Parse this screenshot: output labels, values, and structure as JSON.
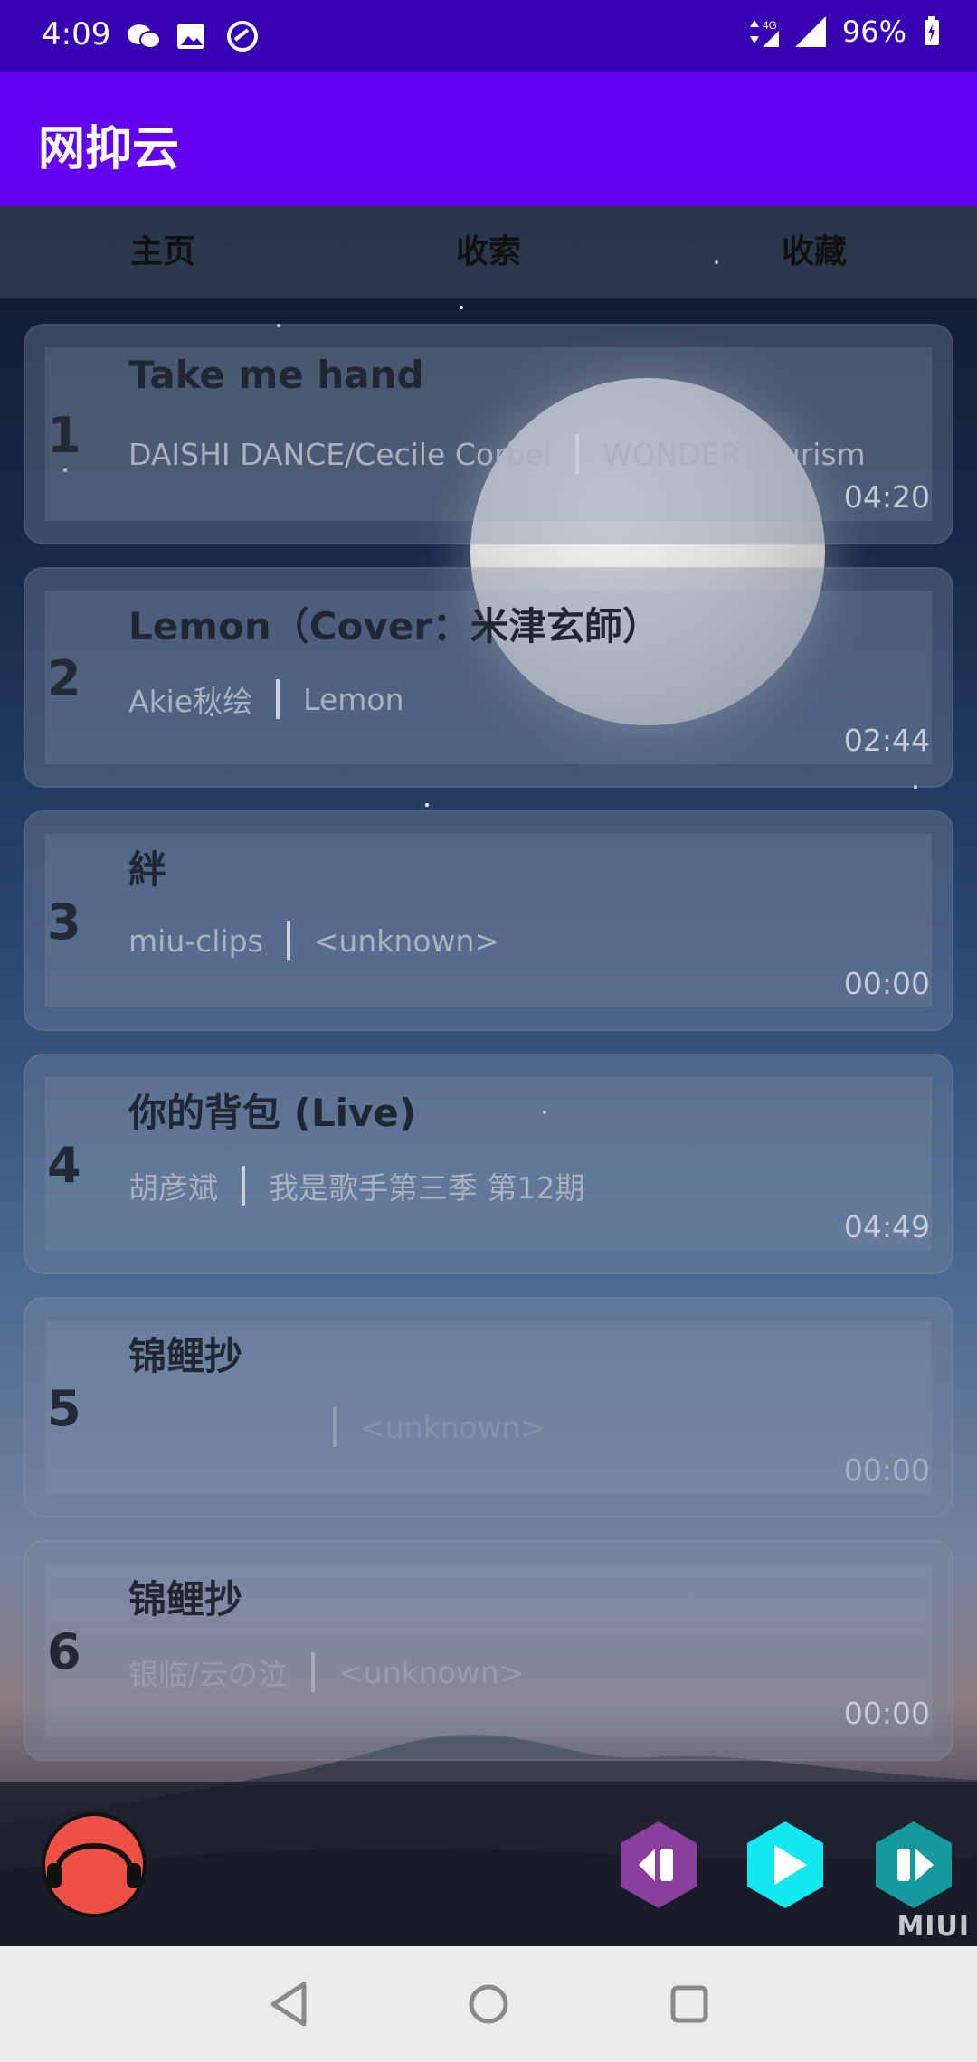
{
  "status_bar": {
    "time": "4:09",
    "network": "4G",
    "battery": "96%",
    "icons": [
      "wechat-icon",
      "image-icon",
      "location-icon",
      "data-arrows-icon",
      "signal-icon",
      "battery-charging-icon"
    ]
  },
  "app_bar": {
    "title": "网抑云"
  },
  "tabs": [
    {
      "label": "主页"
    },
    {
      "label": "收索"
    },
    {
      "label": "收藏"
    }
  ],
  "songs": [
    {
      "index": "1",
      "title": "Take me hand",
      "artist": "DAISHI DANCE/Cecile Corbel",
      "album": "WONDER Tourism",
      "duration": "04:20"
    },
    {
      "index": "2",
      "title": "Lemon（Cover：米津玄師）",
      "artist": "Akie秋绘",
      "album": "Lemon",
      "duration": "02:44"
    },
    {
      "index": "3",
      "title": "絆",
      "artist": "miu-clips",
      "album": "<unknown>",
      "duration": "00:00"
    },
    {
      "index": "4",
      "title": "你的背包 (Live)",
      "artist": "胡彦斌",
      "album": "我是歌手第三季 第12期",
      "duration": "04:49"
    },
    {
      "index": "5",
      "title": "锦鲤抄",
      "artist": "",
      "album": "<unknown>",
      "duration": "00:00"
    },
    {
      "index": "6",
      "title": "锦鲤抄",
      "artist": "银临/云の泣",
      "album": "<unknown>",
      "duration": "00:00"
    }
  ],
  "player": {
    "avatar_icon": "headphones-icon",
    "avatar_color": "#ef5046",
    "prev_color": "#8a3ea0",
    "play_color": "#12e8f0",
    "next_color": "#129a9c",
    "watermark": "MIUI"
  },
  "nav_bar": {
    "icons": [
      "back-icon",
      "home-icon",
      "recents-icon"
    ]
  }
}
